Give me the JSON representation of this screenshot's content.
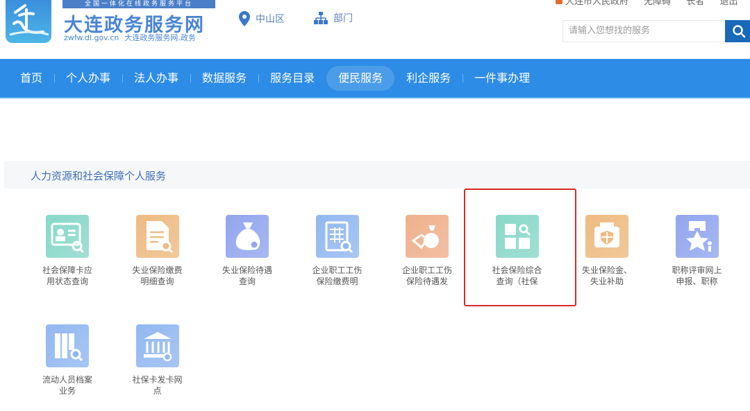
{
  "top_links": [
    "大连市人民政府",
    "无障碍",
    "长者",
    "退出"
  ],
  "header": {
    "slogan": "全国一体化在线政务服务平台",
    "site_name": "大连政务服务网",
    "site_url": "zwfw.dl.gov.cn",
    "site_domain": "大连政务服务网.政务",
    "location": "中山区",
    "department": "部门",
    "search_placeholder": "请输入您想找的服务"
  },
  "nav": [
    {
      "label": "首页"
    },
    {
      "label": "个人办事"
    },
    {
      "label": "法人办事"
    },
    {
      "label": "数据服务"
    },
    {
      "label": "服务目录"
    },
    {
      "label": "便民服务",
      "active": true
    },
    {
      "label": "利企服务"
    },
    {
      "label": "一件事办理"
    }
  ],
  "section": {
    "title": "人力资源和社会保障个人服务"
  },
  "services": [
    {
      "l1": "社会保障卡应",
      "l2": "用状态查询",
      "icon": "id-card-search-icon",
      "color": "#88d8c8"
    },
    {
      "l1": "失业保险缴费",
      "l2": "明细查询",
      "icon": "document-search-icon",
      "color": "#eebb82"
    },
    {
      "l1": "失业保险待遇",
      "l2": "查询",
      "icon": "money-bag-icon",
      "color": "#92a6ee"
    },
    {
      "l1": "企业职工工伤",
      "l2": "保险缴费明",
      "icon": "clipboard-search-icon",
      "color": "#92b8f0"
    },
    {
      "l1": "企业职工工伤",
      "l2": "保险待遇发",
      "icon": "hand-money-icon",
      "color": "#efb08c"
    },
    {
      "l1": "社会保险综合",
      "l2": "查询（社保",
      "icon": "grid-search-icon",
      "color": "#88d8c8"
    },
    {
      "l1": "失业保险金、",
      "l2": "失业补助",
      "icon": "shield-box-icon",
      "color": "#eebb82"
    },
    {
      "l1": "职称评审网上",
      "l2": "申报、职称",
      "icon": "star-medal-icon",
      "color": "#92a6ee"
    },
    {
      "l1": "流动人员档案",
      "l2": "业务",
      "icon": "archive-search-icon",
      "color": "#92b8f0"
    },
    {
      "l1": "社保卡发卡网",
      "l2": "点",
      "icon": "bank-icon",
      "color": "#92b8f0"
    }
  ]
}
